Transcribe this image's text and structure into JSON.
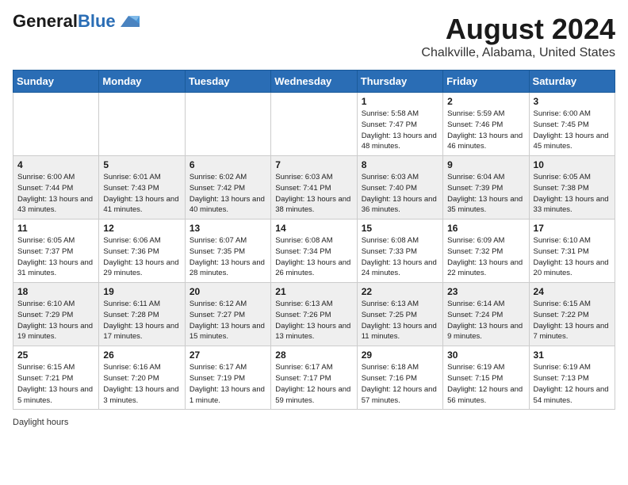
{
  "header": {
    "logo_general": "General",
    "logo_blue": "Blue",
    "title": "August 2024",
    "subtitle": "Chalkville, Alabama, United States"
  },
  "columns": [
    "Sunday",
    "Monday",
    "Tuesday",
    "Wednesday",
    "Thursday",
    "Friday",
    "Saturday"
  ],
  "weeks": [
    [
      {
        "day": "",
        "info": ""
      },
      {
        "day": "",
        "info": ""
      },
      {
        "day": "",
        "info": ""
      },
      {
        "day": "",
        "info": ""
      },
      {
        "day": "1",
        "info": "Sunrise: 5:58 AM\nSunset: 7:47 PM\nDaylight: 13 hours and 48 minutes."
      },
      {
        "day": "2",
        "info": "Sunrise: 5:59 AM\nSunset: 7:46 PM\nDaylight: 13 hours and 46 minutes."
      },
      {
        "day": "3",
        "info": "Sunrise: 6:00 AM\nSunset: 7:45 PM\nDaylight: 13 hours and 45 minutes."
      }
    ],
    [
      {
        "day": "4",
        "info": "Sunrise: 6:00 AM\nSunset: 7:44 PM\nDaylight: 13 hours and 43 minutes."
      },
      {
        "day": "5",
        "info": "Sunrise: 6:01 AM\nSunset: 7:43 PM\nDaylight: 13 hours and 41 minutes."
      },
      {
        "day": "6",
        "info": "Sunrise: 6:02 AM\nSunset: 7:42 PM\nDaylight: 13 hours and 40 minutes."
      },
      {
        "day": "7",
        "info": "Sunrise: 6:03 AM\nSunset: 7:41 PM\nDaylight: 13 hours and 38 minutes."
      },
      {
        "day": "8",
        "info": "Sunrise: 6:03 AM\nSunset: 7:40 PM\nDaylight: 13 hours and 36 minutes."
      },
      {
        "day": "9",
        "info": "Sunrise: 6:04 AM\nSunset: 7:39 PM\nDaylight: 13 hours and 35 minutes."
      },
      {
        "day": "10",
        "info": "Sunrise: 6:05 AM\nSunset: 7:38 PM\nDaylight: 13 hours and 33 minutes."
      }
    ],
    [
      {
        "day": "11",
        "info": "Sunrise: 6:05 AM\nSunset: 7:37 PM\nDaylight: 13 hours and 31 minutes."
      },
      {
        "day": "12",
        "info": "Sunrise: 6:06 AM\nSunset: 7:36 PM\nDaylight: 13 hours and 29 minutes."
      },
      {
        "day": "13",
        "info": "Sunrise: 6:07 AM\nSunset: 7:35 PM\nDaylight: 13 hours and 28 minutes."
      },
      {
        "day": "14",
        "info": "Sunrise: 6:08 AM\nSunset: 7:34 PM\nDaylight: 13 hours and 26 minutes."
      },
      {
        "day": "15",
        "info": "Sunrise: 6:08 AM\nSunset: 7:33 PM\nDaylight: 13 hours and 24 minutes."
      },
      {
        "day": "16",
        "info": "Sunrise: 6:09 AM\nSunset: 7:32 PM\nDaylight: 13 hours and 22 minutes."
      },
      {
        "day": "17",
        "info": "Sunrise: 6:10 AM\nSunset: 7:31 PM\nDaylight: 13 hours and 20 minutes."
      }
    ],
    [
      {
        "day": "18",
        "info": "Sunrise: 6:10 AM\nSunset: 7:29 PM\nDaylight: 13 hours and 19 minutes."
      },
      {
        "day": "19",
        "info": "Sunrise: 6:11 AM\nSunset: 7:28 PM\nDaylight: 13 hours and 17 minutes."
      },
      {
        "day": "20",
        "info": "Sunrise: 6:12 AM\nSunset: 7:27 PM\nDaylight: 13 hours and 15 minutes."
      },
      {
        "day": "21",
        "info": "Sunrise: 6:13 AM\nSunset: 7:26 PM\nDaylight: 13 hours and 13 minutes."
      },
      {
        "day": "22",
        "info": "Sunrise: 6:13 AM\nSunset: 7:25 PM\nDaylight: 13 hours and 11 minutes."
      },
      {
        "day": "23",
        "info": "Sunrise: 6:14 AM\nSunset: 7:24 PM\nDaylight: 13 hours and 9 minutes."
      },
      {
        "day": "24",
        "info": "Sunrise: 6:15 AM\nSunset: 7:22 PM\nDaylight: 13 hours and 7 minutes."
      }
    ],
    [
      {
        "day": "25",
        "info": "Sunrise: 6:15 AM\nSunset: 7:21 PM\nDaylight: 13 hours and 5 minutes."
      },
      {
        "day": "26",
        "info": "Sunrise: 6:16 AM\nSunset: 7:20 PM\nDaylight: 13 hours and 3 minutes."
      },
      {
        "day": "27",
        "info": "Sunrise: 6:17 AM\nSunset: 7:19 PM\nDaylight: 13 hours and 1 minute."
      },
      {
        "day": "28",
        "info": "Sunrise: 6:17 AM\nSunset: 7:17 PM\nDaylight: 12 hours and 59 minutes."
      },
      {
        "day": "29",
        "info": "Sunrise: 6:18 AM\nSunset: 7:16 PM\nDaylight: 12 hours and 57 minutes."
      },
      {
        "day": "30",
        "info": "Sunrise: 6:19 AM\nSunset: 7:15 PM\nDaylight: 12 hours and 56 minutes."
      },
      {
        "day": "31",
        "info": "Sunrise: 6:19 AM\nSunset: 7:13 PM\nDaylight: 12 hours and 54 minutes."
      }
    ]
  ],
  "footer": {
    "daylight_hours_label": "Daylight hours"
  }
}
